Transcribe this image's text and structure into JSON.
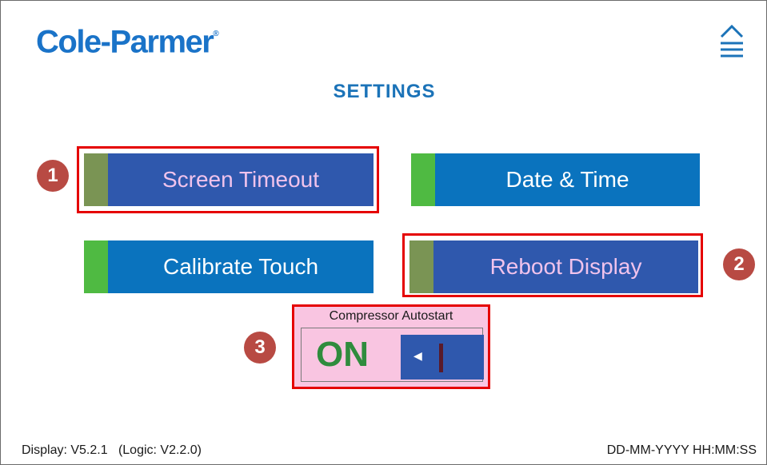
{
  "header": {
    "logo_text": "Cole-Parmer",
    "logo_mark": "®",
    "menu_icon": "home-stack-icon",
    "title": "SETTINGS"
  },
  "buttons": {
    "screen_timeout": "Screen Timeout",
    "date_time": "Date & Time",
    "calibrate_touch": "Calibrate Touch",
    "reboot_display": "Reboot Display"
  },
  "compressor": {
    "label": "Compressor Autostart",
    "state": "ON",
    "toggle_arrow": "◀"
  },
  "badges": [
    "1",
    "2",
    "3"
  ],
  "footer": {
    "version": "Display: V5.2.1   (Logic: V2.2.0)",
    "datetime": "DD-MM-YYYY HH:MM:SS"
  },
  "colors": {
    "brand_blue": "#1b73b8",
    "button_blue": "#0a73be",
    "accent_green": "#4fba42",
    "highlight_red": "#e50000",
    "badge_red": "#b84a43",
    "selected_button": "#2f58ad",
    "selected_text": "#f0c3ec",
    "compressor_bg": "#f9c5e1"
  }
}
